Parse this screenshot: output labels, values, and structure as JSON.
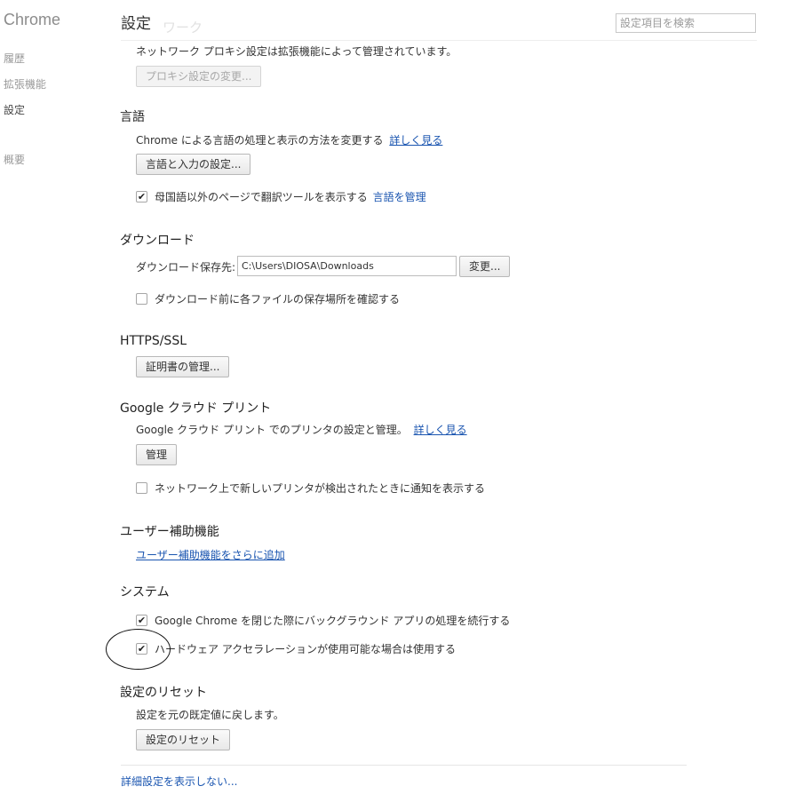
{
  "sidebar": {
    "brand": "Chrome",
    "items": [
      {
        "label": "履歴"
      },
      {
        "label": "拡張機能"
      },
      {
        "label": "設定"
      },
      {
        "label": "概要"
      }
    ]
  },
  "header": {
    "title": "設定",
    "ghost_title": "ワーク",
    "search_placeholder": "設定項目を検索"
  },
  "network": {
    "desc": "ネットワーク プロキシ設定は拡張機能によって管理されています。",
    "proxy_button": "プロキシ設定の変更..."
  },
  "language": {
    "heading": "言語",
    "desc": "Chrome による言語の処理と表示の方法を変更する",
    "learn_more": "詳しく見る",
    "settings_button": "言語と入力の設定...",
    "translate_label": "母国語以外のページで翻訳ツールを表示する",
    "translate_checked": "✔",
    "manage_languages": "言語を管理"
  },
  "downloads": {
    "heading": "ダウンロード",
    "location_label": "ダウンロード保存先:",
    "location_value": "C:\\Users\\DIOSA\\Downloads",
    "change_button": "変更...",
    "ask_label": "ダウンロード前に各ファイルの保存場所を確認する",
    "ask_checked": ""
  },
  "https": {
    "heading": "HTTPS/SSL",
    "certs_button": "証明書の管理..."
  },
  "cloud_print": {
    "heading": "Google クラウド プリント",
    "desc": "Google クラウド プリント でのプリンタの設定と管理。",
    "learn_more": "詳しく見る",
    "manage_button": "管理",
    "notify_label": "ネットワーク上で新しいプリンタが検出されたときに通知を表示する",
    "notify_checked": ""
  },
  "accessibility": {
    "heading": "ユーザー補助機能",
    "add_link": "ユーザー補助機能をさらに追加"
  },
  "system": {
    "heading": "システム",
    "background_label": "Google Chrome を閉じた際にバックグラウンド アプリの処理を続行する",
    "background_checked": "✔",
    "hwaccel_label": "ハードウェア アクセラレーションが使用可能な場合は使用する",
    "hwaccel_checked": "✔"
  },
  "reset": {
    "heading": "設定のリセット",
    "desc": "設定を元の既定値に戻します。",
    "reset_button": "設定のリセット"
  },
  "footer": {
    "hide_advanced": "詳細設定を表示しない..."
  },
  "colors": {
    "link": "#1a55b0",
    "annotation": "#111111"
  }
}
